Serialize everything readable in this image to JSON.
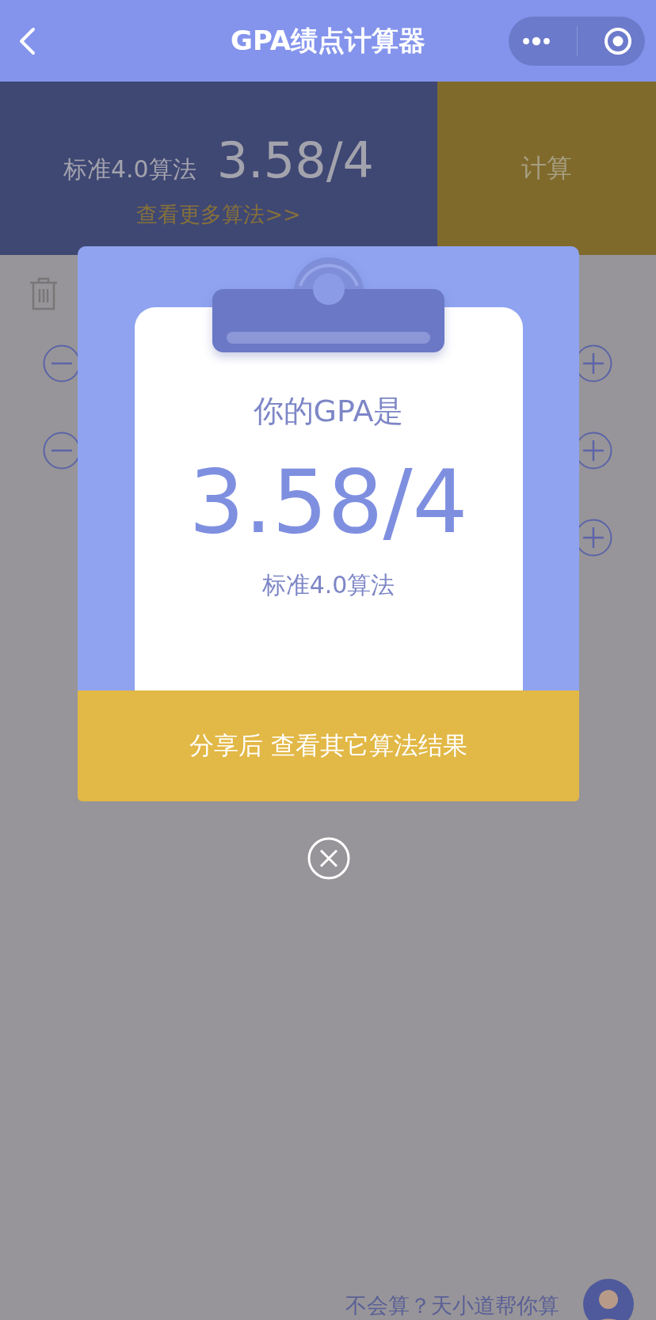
{
  "nav": {
    "title": "GPA绩点计算器"
  },
  "summary": {
    "method": "标准4.0算法",
    "score": "3.58/4",
    "more_link": "查看更多算法>>",
    "calc_button": "计算"
  },
  "rows": [
    {
      "removable": true
    },
    {
      "removable": true
    },
    {
      "removable": false
    }
  ],
  "modal": {
    "heading": "你的GPA是",
    "score": "3.58/4",
    "method": "标准4.0算法",
    "share_button": "分享后 查看其它算法结果"
  },
  "footer": {
    "help_link": "不会算？天小道帮你算"
  }
}
